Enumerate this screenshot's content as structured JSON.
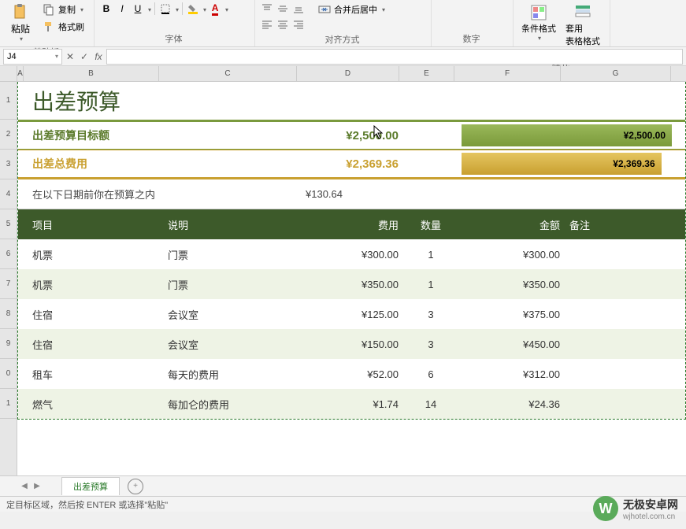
{
  "ribbon": {
    "clipboard": {
      "paste": "粘贴",
      "copy": "复制",
      "formatPainter": "格式刷",
      "group": "剪贴板"
    },
    "font": {
      "bold": "B",
      "italic": "I",
      "underline": "U",
      "group": "字体"
    },
    "alignment": {
      "mergeCenter": "合并后居中",
      "group": "对齐方式"
    },
    "number": {
      "group": "数字"
    },
    "styles": {
      "conditional": "条件格式",
      "formatTable": "套用\n表格格式",
      "group": "样式"
    }
  },
  "namebox": "J4",
  "formulabar_fx": "fx",
  "cols": [
    "A",
    "B",
    "C",
    "D",
    "E",
    "F",
    "G"
  ],
  "rows_top": [
    "1",
    "2",
    "3",
    "4",
    "5"
  ],
  "rows_body": [
    "6",
    "7",
    "8",
    "9",
    "0",
    "1"
  ],
  "doc": {
    "title": "出差预算",
    "budget_label": "出差预算目标额",
    "budget_value": "¥2,500.00",
    "budget_bar": "¥2,500.00",
    "total_label": "出差总费用",
    "total_value": "¥2,369.36",
    "total_bar": "¥2,369.36",
    "remaining_label": "在以下日期前你在预算之内",
    "remaining_value": "¥130.64",
    "headers": {
      "item": "项目",
      "desc": "说明",
      "cost": "费用",
      "qty": "数量",
      "amount": "金额",
      "notes": "备注"
    },
    "rows": [
      {
        "item": "机票",
        "desc": "门票",
        "cost": "¥300.00",
        "qty": "1",
        "amount": "¥300.00"
      },
      {
        "item": "机票",
        "desc": "门票",
        "cost": "¥350.00",
        "qty": "1",
        "amount": "¥350.00"
      },
      {
        "item": "住宿",
        "desc": "会议室",
        "cost": "¥125.00",
        "qty": "3",
        "amount": "¥375.00"
      },
      {
        "item": "住宿",
        "desc": "会议室",
        "cost": "¥150.00",
        "qty": "3",
        "amount": "¥450.00"
      },
      {
        "item": "租车",
        "desc": "每天的费用",
        "cost": "¥52.00",
        "qty": "6",
        "amount": "¥312.00"
      },
      {
        "item": "燃气",
        "desc": "每加仑的费用",
        "cost": "¥1.74",
        "qty": "14",
        "amount": "¥24.36"
      }
    ]
  },
  "sheet_tab": "出差预算",
  "status": "定目标区域，然后按 ENTER 或选择\"粘贴\"",
  "watermark": {
    "logo": "W",
    "title": "无极安卓网",
    "url": "wjhotel.com.cn"
  },
  "chart_data": {
    "type": "table",
    "title": "出差预算",
    "summary": {
      "budget_target": 2500.0,
      "total_expense": 2369.36,
      "remaining": 130.64,
      "currency": "¥"
    },
    "columns": [
      "项目",
      "说明",
      "费用",
      "数量",
      "金额",
      "备注"
    ],
    "rows": [
      [
        "机票",
        "门票",
        300.0,
        1,
        300.0,
        ""
      ],
      [
        "机票",
        "门票",
        350.0,
        1,
        350.0,
        ""
      ],
      [
        "住宿",
        "会议室",
        125.0,
        3,
        375.0,
        ""
      ],
      [
        "住宿",
        "会议室",
        150.0,
        3,
        450.0,
        ""
      ],
      [
        "租车",
        "每天的费用",
        52.0,
        6,
        312.0,
        ""
      ],
      [
        "燃气",
        "每加仑的费用",
        1.74,
        14,
        24.36,
        ""
      ]
    ]
  }
}
